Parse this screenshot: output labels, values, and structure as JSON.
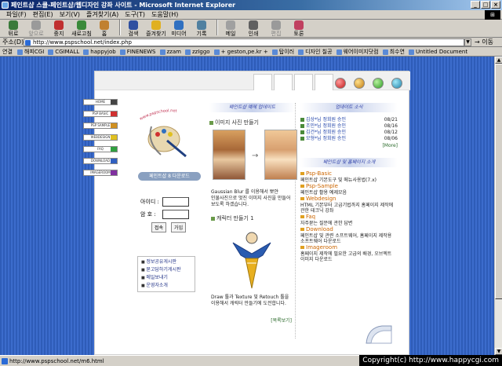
{
  "window": {
    "title": "페인트샵 스쿨-페인트샵/웹디자인 강좌 사이트 - Microsoft Internet Explorer"
  },
  "menu": [
    "파일(F)",
    "편집(E)",
    "보기(V)",
    "즐겨찾기(A)",
    "도구(T)",
    "도움말(H)"
  ],
  "toolbar": [
    {
      "label": "뒤로",
      "icon": "back-arrow-icon",
      "color": "#3a7a3a",
      "enabled": true
    },
    {
      "label": "앞으로",
      "icon": "forward-arrow-icon",
      "color": "#9a9a9a",
      "enabled": false
    },
    {
      "label": "중지",
      "icon": "stop-icon",
      "color": "#c03030",
      "enabled": true
    },
    {
      "label": "새로고침",
      "icon": "refresh-icon",
      "color": "#3a8a3a",
      "enabled": true
    },
    {
      "label": "홈",
      "icon": "home-icon",
      "color": "#c08030",
      "enabled": true
    },
    {
      "label": "검색",
      "icon": "search-icon",
      "color": "#3050a0",
      "enabled": true
    },
    {
      "label": "즐겨찾기",
      "icon": "favorites-icon",
      "color": "#e0b020",
      "enabled": true
    },
    {
      "label": "미디어",
      "icon": "media-icon",
      "color": "#3070c0",
      "enabled": true
    },
    {
      "label": "기록",
      "icon": "history-icon",
      "color": "#5080a0",
      "enabled": true
    },
    {
      "label": "메일",
      "icon": "mail-icon",
      "color": "#a0a0a0",
      "enabled": true
    },
    {
      "label": "인쇄",
      "icon": "print-icon",
      "color": "#606060",
      "enabled": true
    },
    {
      "label": "편집",
      "icon": "edit-icon",
      "color": "#9a9a9a",
      "enabled": false
    },
    {
      "label": "토론",
      "icon": "discuss-icon",
      "color": "#c04060",
      "enabled": true
    }
  ],
  "address": {
    "label": "주소(D)",
    "url": "http://www.pspschool.net/index.php",
    "go": "이동"
  },
  "links": {
    "label": "연결",
    "items": [
      "해피CGI",
      "CGIMALL",
      "happyjob",
      "FINENEWS",
      "zzam",
      "zzIggo",
      "+ geston,pe.kr +",
      "탑이러",
      "디자인 칠공",
      "웨어이미지닷컴",
      "최수연",
      "Untitled Document"
    ]
  },
  "status": {
    "text": "http://www.pspschool.net/m6.html"
  },
  "copyright": "Copyright(c) http://www.happycgi.com",
  "site": {
    "tubes": [
      {
        "label": "HOME",
        "color": "#444444"
      },
      {
        "label": "PSP BASIC",
        "color": "#d03030"
      },
      {
        "label": "PSP SAMPLE",
        "color": "#d09020"
      },
      {
        "label": "WEBDESIGN",
        "color": "#e0c020"
      },
      {
        "label": "FAQ",
        "color": "#30a040"
      },
      {
        "label": "DOWNLOAD",
        "color": "#3060c0"
      },
      {
        "label": "IMAGEROOM",
        "color": "#8030a0"
      }
    ],
    "logo_text": "www.pspschool.net",
    "download_btn": "페인트샵 8 다운로드",
    "login": {
      "id_label": "아이디 :",
      "pw_label": "암  호 :",
      "login_btn": "접속",
      "join_btn": "가입"
    },
    "info_links": [
      "정보공유게시판",
      "묻고답하기게시판",
      "메일보내기",
      "운영자소개"
    ],
    "update_banner": "페인트샵 예제 업데이트",
    "item1_title": "이미지 사진 만들기",
    "item1_desc": "Gaussian Blur 를 이용해서 뽀얀 인물사진으로 멋진 이미지 사진을 만들어 보도록 하겠습니다.",
    "item2_title": "캐릭터 만들기 1",
    "item2_desc": "Draw 툴과 Texture 및 Retouch 툴을 이용해서 캐릭터 만들기에 도전합니다.",
    "list_more": "[목록보기]",
    "news_banner": "업데이트 소식",
    "news": [
      {
        "title": "김상*님 정회원 승인",
        "date": "08/21"
      },
      {
        "title": "조민*님 정회원 승인",
        "date": "08/16"
      },
      {
        "title": "김건*님 정회원 승인",
        "date": "08/12"
      },
      {
        "title": "모형*님 정회원 승인",
        "date": "08/06"
      }
    ],
    "news_more": "[More]",
    "dl_banner": "페인트샵 및 홈페이지 소개",
    "dl": [
      {
        "title": "Psp-Basic",
        "desc": "페인트샵 기본도구 및 메뉴사용법(7.x)"
      },
      {
        "title": "Psp-Sample",
        "desc": "페인트샵 활용 예제모음"
      },
      {
        "title": "Webdesign",
        "desc": "HTML 기본부터 고급기법까지 홈페이지 제작에 관한 테크닉 강좌"
      },
      {
        "title": "Faq",
        "desc": "자주묻는 질문에 관한 답변"
      },
      {
        "title": "Download",
        "desc": "페인트샵 및 관련 소프트웨어, 홈페이지 제작용 소프트웨어 다운로드"
      },
      {
        "title": "Imageroom",
        "desc": "홈페이지 제작에 필요한 고급의 배경, 오브젝트 이미지 다운로드"
      }
    ]
  }
}
